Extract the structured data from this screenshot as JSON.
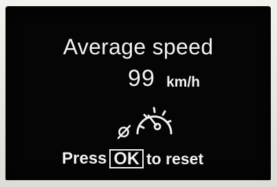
{
  "display": {
    "title": "Average speed",
    "speed_value": "99",
    "speed_unit": "km/h",
    "instruction": {
      "press_label": "Press",
      "button_label": "OK",
      "action_label": "to reset"
    },
    "reset_symbol": "ø",
    "icon": "speedometer-gauge-icon"
  },
  "colors": {
    "screen_background": "#050505",
    "text": "#f2f2f2"
  }
}
